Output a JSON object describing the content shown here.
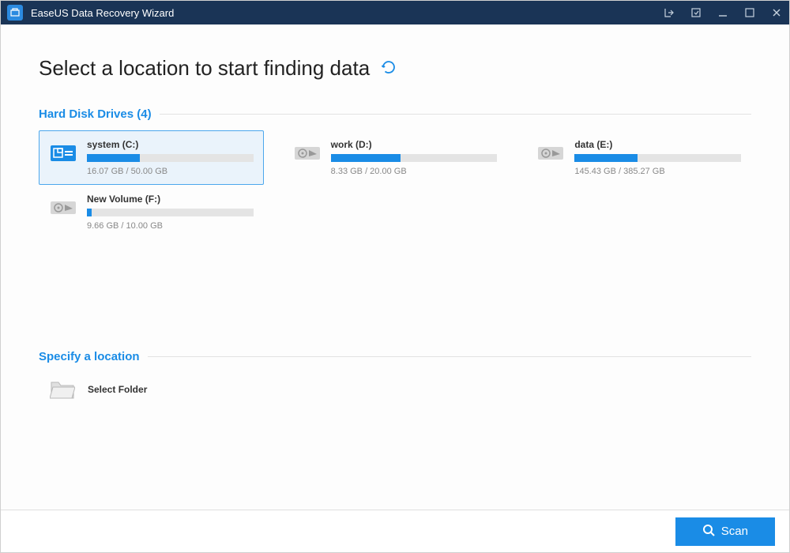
{
  "titlebar": {
    "title": "EaseUS Data Recovery Wizard"
  },
  "heading": "Select a location to start finding data",
  "sections": {
    "drives_title": "Hard Disk Drives (4)",
    "specify_title": "Specify a location"
  },
  "drives": [
    {
      "name": "system (C:)",
      "used": "16.07 GB",
      "total": "50.00 GB",
      "pct": 32,
      "selected": true,
      "system": true
    },
    {
      "name": "work (D:)",
      "used": "8.33 GB",
      "total": "20.00 GB",
      "pct": 42,
      "selected": false,
      "system": false
    },
    {
      "name": "data (E:)",
      "used": "145.43 GB",
      "total": "385.27 GB",
      "pct": 38,
      "selected": false,
      "system": false
    },
    {
      "name": "New Volume (F:)",
      "used": "9.66 GB",
      "total": "10.00 GB",
      "pct": 3,
      "selected": false,
      "system": false
    }
  ],
  "specify": {
    "folder_label": "Select Folder"
  },
  "footer": {
    "scan_label": "Scan"
  }
}
